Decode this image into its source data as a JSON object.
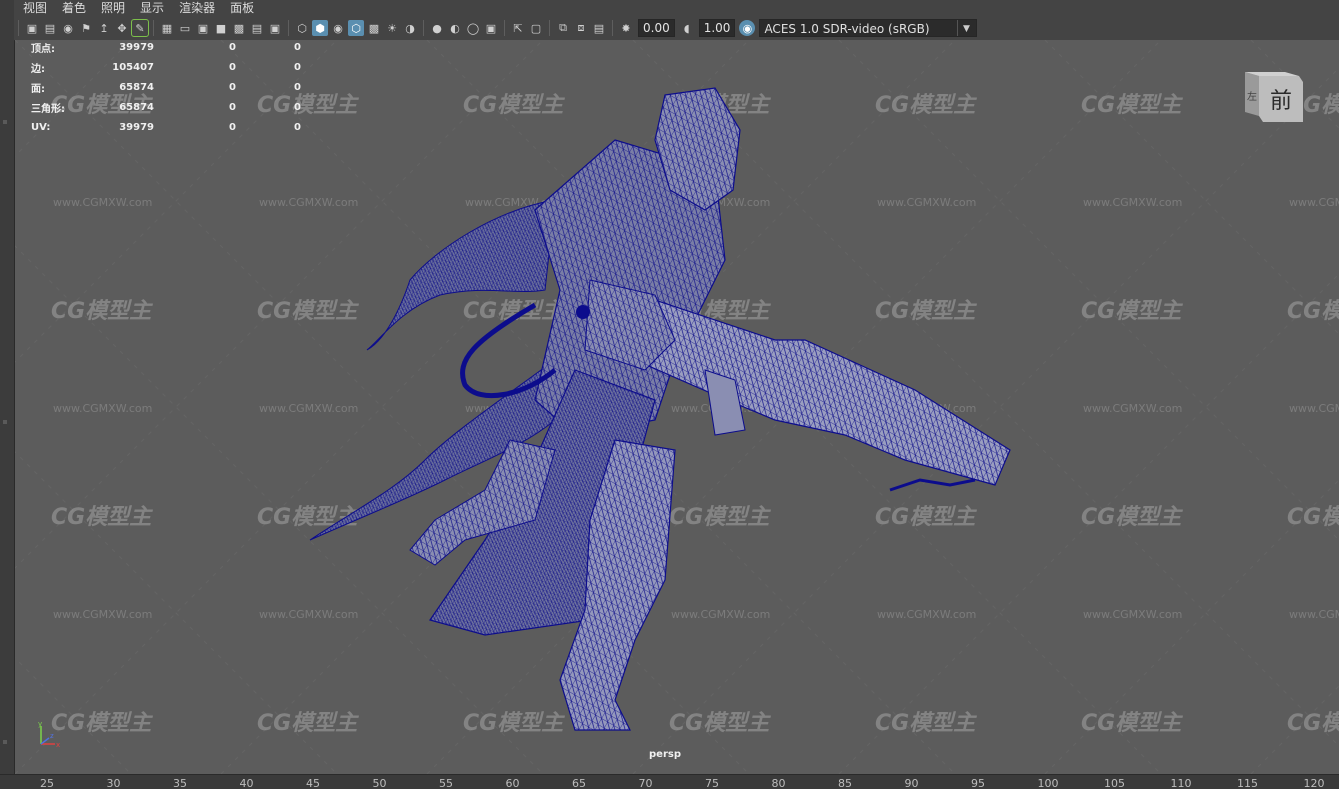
{
  "menu": [
    "视图",
    "着色",
    "照明",
    "显示",
    "渲染器",
    "面板"
  ],
  "toolbar": {
    "exposure_value": "0.00",
    "gamma_value": "1.00",
    "color_space": "ACES 1.0 SDR-video (sRGB)"
  },
  "stats": [
    {
      "label": "顶点:",
      "v1": "39979",
      "v2": "0",
      "v3": "0"
    },
    {
      "label": "边:",
      "v1": "105407",
      "v2": "0",
      "v3": "0"
    },
    {
      "label": "面:",
      "v1": "65874",
      "v2": "0",
      "v3": "0"
    },
    {
      "label": "三角形:",
      "v1": "65874",
      "v2": "0",
      "v3": "0"
    },
    {
      "label": "UV:",
      "v1": "39979",
      "v2": "0",
      "v3": "0"
    }
  ],
  "viewcube": {
    "face": "前",
    "side": "左"
  },
  "camera_label": "persp",
  "watermark": {
    "logo": "CG模型主",
    "url": "www.CGMXW.com"
  },
  "axis": {
    "y": "y",
    "x": "x",
    "z": "z"
  },
  "ruler_ticks": [
    "25",
    "30",
    "35",
    "40",
    "45",
    "50",
    "55",
    "60",
    "65",
    "70",
    "75",
    "80",
    "85",
    "90",
    "95",
    "100",
    "105",
    "110",
    "115",
    "120"
  ],
  "colors": {
    "wireframe": "#0c0c8c",
    "viewport_bg": "#5c5c5c",
    "accent": "#5a8fb0"
  }
}
